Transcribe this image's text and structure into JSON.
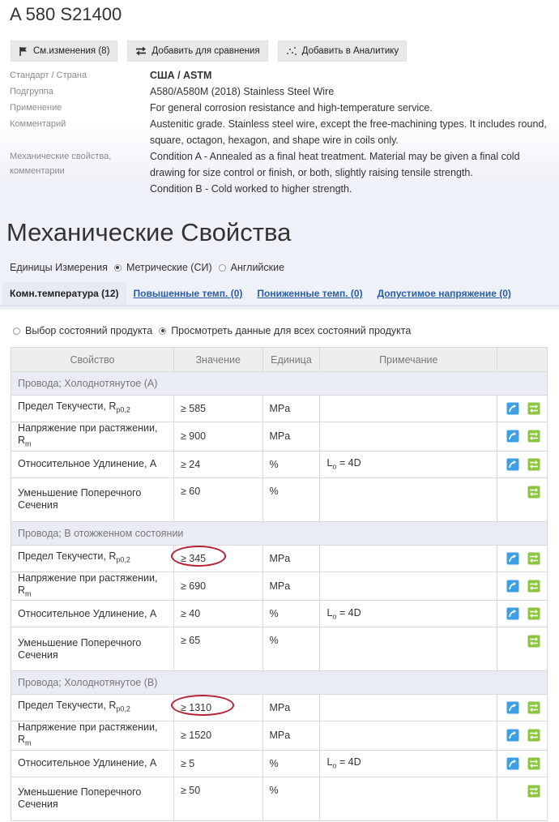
{
  "title": "A 580 S21400",
  "actions": {
    "changes": "См.изменения (8)",
    "compare": "Добавить для сравнения",
    "analytics": "Добавить в Аналитику"
  },
  "meta": {
    "standard_label": "Стандарт / Страна",
    "standard_value": "США / ASTM",
    "subgroup_label": "Подгруппа",
    "subgroup_value": "A580/A580M (2018) Stainless Steel Wire",
    "application_label": "Применение",
    "application_value": "For general corrosion resistance and high-temperature service.",
    "comment_label": "Комментарий",
    "comment_value": "Austenitic grade. Stainless steel wire, except the free-machining types. It includes round, square, octagon, hexagon, and shape wire in coils only.",
    "mech_label": "Механические свойства, комментарии",
    "mech_value_1": "Condition A - Annealed as a final heat treatment. Material may be given a final cold drawing for size control or finish, or both, slightly raising tensile strength.",
    "mech_value_2": "Condition B - Cold worked to higher strength."
  },
  "section_title": "Механические Свойства",
  "units": {
    "label": "Единицы Измерения",
    "metric": "Метрические (СИ)",
    "english": "Английские",
    "selected": "metric"
  },
  "tabs": [
    {
      "label": "Комн.температура (12)",
      "active": true
    },
    {
      "label": "Повышенные темп. (0)",
      "active": false
    },
    {
      "label": "Пониженные темп. (0)",
      "active": false
    },
    {
      "label": "Допустимое напряжение (0)",
      "active": false
    }
  ],
  "view": {
    "select": "Выбор состояний продукта",
    "all": "Просмотреть данные для всех состояний продукта",
    "selected": "all"
  },
  "table": {
    "headers": [
      "Свойство",
      "Значение",
      "Единица",
      "Примечание",
      ""
    ],
    "groups": [
      {
        "name": "Провода; Холоднотянутое (A)",
        "rows": [
          {
            "prop": "Предел Текучести, R",
            "sub": "p0,2",
            "value": "≥ 585",
            "unit": "MPa",
            "note": "",
            "note_sub": "",
            "note_rest": "",
            "chart": true,
            "highlight": false
          },
          {
            "prop": "Напряжение при растяжении, R",
            "sub": "m",
            "value": "≥ 900",
            "unit": "MPa",
            "note": "",
            "note_sub": "",
            "note_rest": "",
            "chart": true,
            "highlight": false
          },
          {
            "prop": "Относительное Удлинение, A",
            "sub": "",
            "value": "≥ 24",
            "unit": "%",
            "note": "L",
            "note_sub": "o",
            "note_rest": " = 4D",
            "chart": true,
            "highlight": false
          },
          {
            "prop": "Уменьшение Поперечного Сечения",
            "sub": "",
            "value": "≥ 60",
            "unit": "%",
            "note": "",
            "note_sub": "",
            "note_rest": "",
            "chart": false,
            "highlight": false
          }
        ]
      },
      {
        "name": "Провода; В отожженном состоянии",
        "rows": [
          {
            "prop": "Предел Текучести, R",
            "sub": "p0,2",
            "value": "≥ 345",
            "unit": "MPa",
            "note": "",
            "note_sub": "",
            "note_rest": "",
            "chart": true,
            "highlight": true
          },
          {
            "prop": "Напряжение при растяжении, R",
            "sub": "m",
            "value": "≥ 690",
            "unit": "MPa",
            "note": "",
            "note_sub": "",
            "note_rest": "",
            "chart": true,
            "highlight": false
          },
          {
            "prop": "Относительное Удлинение, A",
            "sub": "",
            "value": "≥ 40",
            "unit": "%",
            "note": "L",
            "note_sub": "o",
            "note_rest": " = 4D",
            "chart": true,
            "highlight": false
          },
          {
            "prop": "Уменьшение Поперечного Сечения",
            "sub": "",
            "value": "≥ 65",
            "unit": "%",
            "note": "",
            "note_sub": "",
            "note_rest": "",
            "chart": false,
            "highlight": false
          }
        ]
      },
      {
        "name": "Провода; Холоднотянутое (B)",
        "rows": [
          {
            "prop": "Предел Текучести, R",
            "sub": "p0,2",
            "value": "≥ 1310",
            "unit": "MPa",
            "note": "",
            "note_sub": "",
            "note_rest": "",
            "chart": true,
            "highlight": true
          },
          {
            "prop": "Напряжение при растяжении, R",
            "sub": "m",
            "value": "≥ 1520",
            "unit": "MPa",
            "note": "",
            "note_sub": "",
            "note_rest": "",
            "chart": true,
            "highlight": false
          },
          {
            "prop": "Относительное Удлинение, A",
            "sub": "",
            "value": "≥ 5",
            "unit": "%",
            "note": "L",
            "note_sub": "o",
            "note_rest": " = 4D",
            "chart": true,
            "highlight": false
          },
          {
            "prop": "Уменьшение Поперечного Сечения",
            "sub": "",
            "value": "≥ 50",
            "unit": "%",
            "note": "",
            "note_sub": "",
            "note_rest": "",
            "chart": false,
            "highlight": false
          }
        ]
      }
    ]
  },
  "colors": {
    "link": "#2a5da8",
    "highlight_oval": "#b22234",
    "chart_icon": "#3ea0e4",
    "compare_icon": "#8bc63e"
  }
}
